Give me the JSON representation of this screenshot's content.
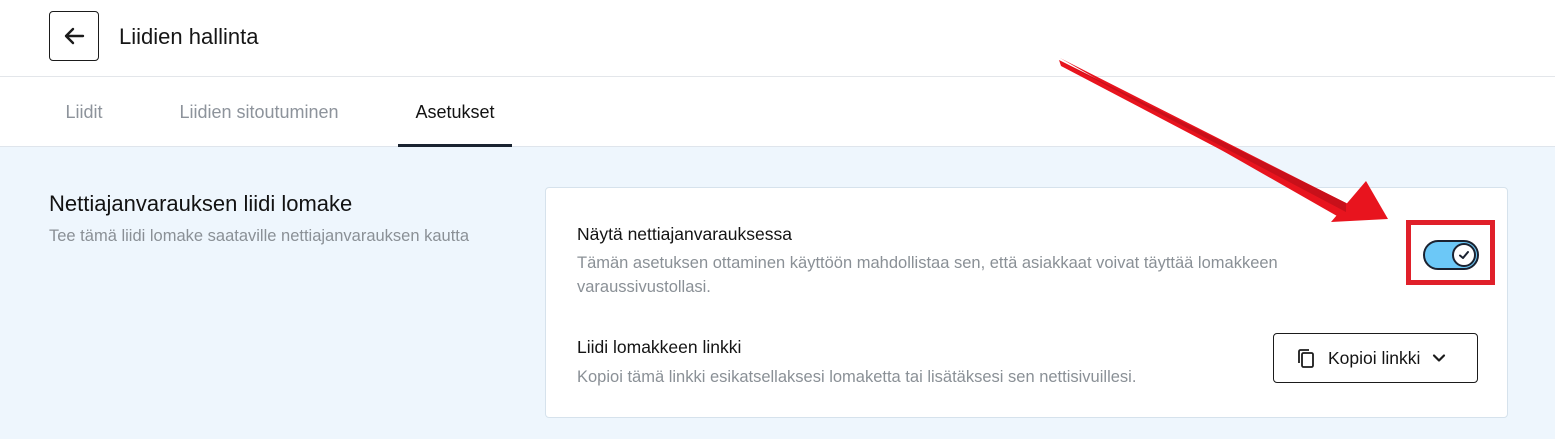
{
  "header": {
    "title": "Liidien hallinta",
    "back_icon": "arrow-left-icon"
  },
  "tabs": [
    {
      "label": "Liidit",
      "active": false
    },
    {
      "label": "Liidien sitoutuminen",
      "active": false
    },
    {
      "label": "Asetukset",
      "active": true
    }
  ],
  "section": {
    "title": "Nettiajanvarauksen liidi lomake",
    "description": "Tee tämä liidi lomake saataville nettiajanvarauksen kautta"
  },
  "settings": {
    "show_in_booking": {
      "title": "Näytä nettiajanvarauksessa",
      "description": "Tämän asetuksen ottaminen käyttöön mahdollistaa sen, että asiakkaat voivat täyttää lomakkeen varaussivustollasi.",
      "enabled": true
    },
    "form_link": {
      "title": "Liidi lomakkeen linkki",
      "description": "Kopioi tämä linkki esikatsellaksesi lomaketta tai lisätäksesi sen nettisivuillesi.",
      "button_label": "Kopioi linkki",
      "button_icon": "copy-icon",
      "dropdown_icon": "chevron-down-icon"
    }
  },
  "colors": {
    "toggle_on": "#6cc8f7",
    "annotation": "#e0202a",
    "content_bg": "#eef6fd"
  }
}
